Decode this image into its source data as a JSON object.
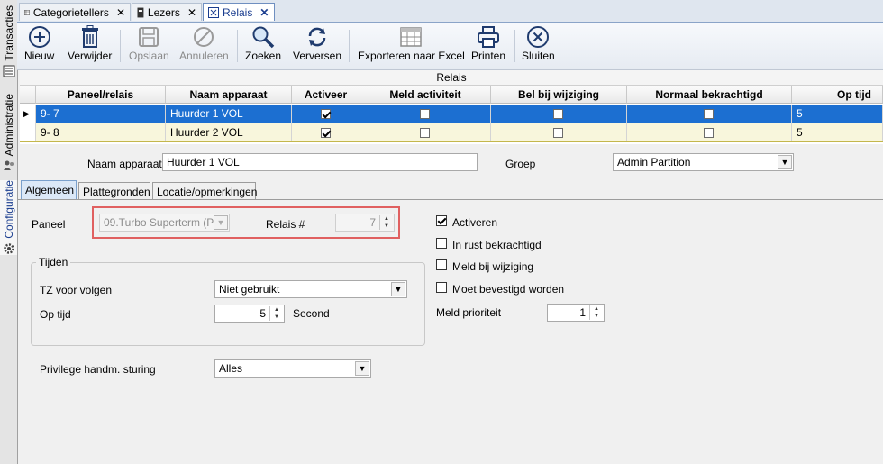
{
  "left_tabs": {
    "transacties": "Transacties",
    "administratie": "Administratie",
    "configuratie": "Configuratie"
  },
  "doc_tabs": [
    {
      "label": "Categorietellers",
      "icon": "grid-icon"
    },
    {
      "label": "Lezers",
      "icon": "reader-icon"
    },
    {
      "label": "Relais",
      "icon": "relay-icon"
    }
  ],
  "toolbar": {
    "new": "Nieuw",
    "delete": "Verwijder",
    "save": "Opslaan",
    "cancel": "Annuleren",
    "search": "Zoeken",
    "refresh": "Verversen",
    "export": "Exporteren naar Excel",
    "print": "Printen",
    "close": "Sluiten"
  },
  "grid": {
    "group_header": "Relais",
    "columns": [
      "Paneel/relais",
      "Naam apparaat",
      "Activeer",
      "Meld activiteit",
      "Bel bij wijziging",
      "Normaal bekrachtigd",
      "Op tijd"
    ],
    "rows": [
      {
        "paneel": "9- 7",
        "naam": "Huurder 1 VOL",
        "activeer": true,
        "meld": false,
        "bel": false,
        "normaal": false,
        "op_tijd": "5"
      },
      {
        "paneel": "9- 8",
        "naam": "Huurder 2 VOL",
        "activeer": true,
        "meld": false,
        "bel": false,
        "normaal": false,
        "op_tijd": "5"
      }
    ]
  },
  "form": {
    "naam_label": "Naam apparaat",
    "naam_value": "Huurder 1 VOL",
    "groep_label": "Groep",
    "groep_value": "Admin Partition",
    "tabs": [
      "Algemeen",
      "Plattegronden",
      "Locatie/opmerkingen"
    ],
    "paneel_label": "Paneel",
    "paneel_value": "09.Turbo Superterm (P",
    "relais_label": "Relais #",
    "relais_value": "7",
    "tijden_label": "Tijden",
    "tz_label": "TZ voor volgen",
    "tz_value": "Niet gebruikt",
    "optijd_label": "Op tijd",
    "optijd_value": "5",
    "optijd_unit": "Second",
    "privilege_label": "Privilege handm. sturing",
    "privilege_value": "Alles",
    "chk_activeren": "Activeren",
    "chk_rust": "In rust bekrachtigd",
    "chk_meld": "Meld bij wijziging",
    "chk_bevestigd": "Moet bevestigd worden",
    "meld_prioriteit_label": "Meld prioriteit",
    "meld_prioriteit_value": "1"
  },
  "colors": {
    "selected_row": "#1c6fd1",
    "alt_row": "#f8f6dc",
    "highlight_box": "#e06060"
  }
}
